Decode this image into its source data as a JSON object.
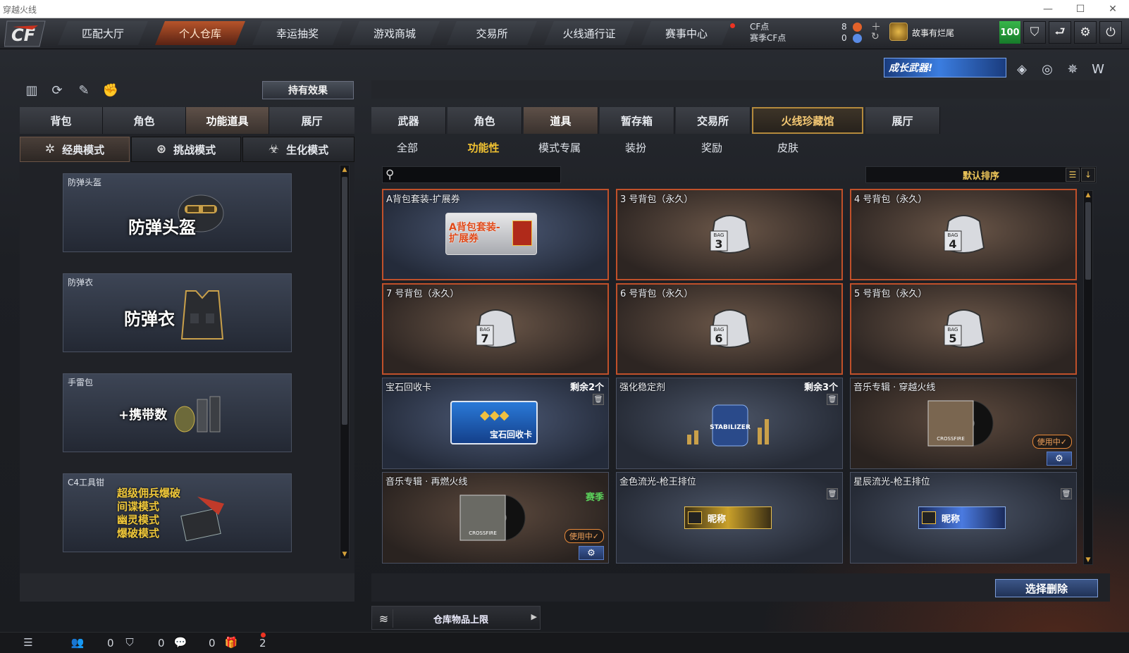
{
  "window": {
    "title": "穿越火线"
  },
  "nav": {
    "tabs": [
      {
        "label": "匹配大厅"
      },
      {
        "label": "个人仓库"
      },
      {
        "label": "幸运抽奖"
      },
      {
        "label": "游戏商城"
      },
      {
        "label": "交易所"
      },
      {
        "label": "火线通行证"
      },
      {
        "label": "赛事中心"
      }
    ],
    "active_tab": "个人仓库"
  },
  "points": {
    "cf_label": "CF点",
    "season_label": "赛季CF点",
    "cf_value": "8",
    "season_value": "0"
  },
  "user": {
    "name": "故事有烂尾",
    "level": "100"
  },
  "promo": {
    "banner": "成长武器!"
  },
  "left": {
    "effects_button": "持有效果",
    "tabs": [
      {
        "label": "背包"
      },
      {
        "label": "角色"
      },
      {
        "label": "功能道具"
      },
      {
        "label": "展厅"
      }
    ],
    "active_tab": "功能道具",
    "modes": [
      {
        "label": "经典模式"
      },
      {
        "label": "挑战模式"
      },
      {
        "label": "生化模式"
      }
    ],
    "active_mode": "经典模式",
    "cards": [
      {
        "title": "防弹头盔",
        "art": "防弹头盔"
      },
      {
        "title": "防弹衣",
        "art": "防弹衣"
      },
      {
        "title": "手雷包",
        "art": "+携带数"
      },
      {
        "title": "C4工具钳",
        "modes": [
          "超级佣兵爆破",
          "间谍模式",
          "幽灵模式",
          "爆破模式"
        ]
      }
    ]
  },
  "right": {
    "tabs": [
      {
        "label": "武器"
      },
      {
        "label": "角色"
      },
      {
        "label": "道具"
      },
      {
        "label": "暂存箱"
      },
      {
        "label": "交易所"
      },
      {
        "label": "火线珍藏馆"
      },
      {
        "label": "展厅"
      }
    ],
    "active_tab": "道具",
    "subtabs": [
      {
        "label": "全部"
      },
      {
        "label": "功能性"
      },
      {
        "label": "模式专属"
      },
      {
        "label": "装扮"
      },
      {
        "label": "奖励"
      },
      {
        "label": "皮肤"
      }
    ],
    "active_subtab": "功能性",
    "search": {
      "placeholder": "",
      "value": ""
    },
    "sort_label": "默认排序",
    "items": [
      {
        "name": "A背包套装-扩展券",
        "art": "A背包套装-扩展券"
      },
      {
        "name": "3 号背包（永久）",
        "bag": "3"
      },
      {
        "name": "4 号背包（永久）",
        "bag": "4"
      },
      {
        "name": "7 号背包（永久）",
        "bag": "7"
      },
      {
        "name": "6 号背包（永久）",
        "bag": "6"
      },
      {
        "name": "5 号背包（永久）",
        "bag": "5"
      },
      {
        "name": "宝石回收卡",
        "remaining": "剩余2个",
        "art": "宝石回收卡"
      },
      {
        "name": "强化稳定剂",
        "remaining": "剩余3个",
        "art": "STABILIZER"
      },
      {
        "name": "音乐专辑 · 穿越火线",
        "status": "使用中✓",
        "art": "CROSSFIRE"
      },
      {
        "name": "音乐专辑 · 再燃火线",
        "tag": "赛季",
        "status": "使用中✓",
        "art": "CROSSFIRE"
      },
      {
        "name": "金色流光-枪王排位",
        "art": "昵称"
      },
      {
        "name": "星辰流光-枪王排位",
        "art": "昵称"
      }
    ],
    "bag_word": "BAG",
    "delete_button": "选择删除",
    "capacity_label": "仓库物品上限"
  },
  "statusbar": {
    "count1": "0",
    "count2": "0",
    "count3": "0",
    "count4": "2"
  },
  "colors": {
    "accent_orange": "#c0502a",
    "gold": "#f1c232",
    "green": "#38b64a",
    "blue_button": "#3c5688"
  },
  "icons": [
    "cf-logo-icon",
    "search-icon",
    "gear-icon",
    "trash-icon",
    "power-icon",
    "shield-icon",
    "chat-icon",
    "gift-icon",
    "list-icon",
    "layers-icon"
  ]
}
